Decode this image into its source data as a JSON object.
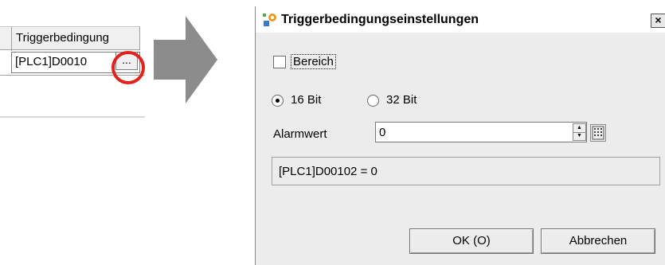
{
  "grid": {
    "column_header": "Triggerbedingung",
    "cell_value": "[PLC1]D0010",
    "ellipsis_label": "..."
  },
  "dialog": {
    "title": "Triggerbedingungseinstellungen",
    "close_label": "×",
    "range_checkbox_label": "Bereich",
    "range_checked": false,
    "radio_16_label": "16 Bit",
    "radio_32_label": "32 Bit",
    "selected_bit_mode": "16 Bit",
    "alarm_label": "Alarmwert",
    "alarm_value": "0",
    "preview_text": "[PLC1]D00102 = 0",
    "ok_label": "OK (O)",
    "cancel_label": "Abbrechen"
  },
  "colors": {
    "highlight_ring": "#e0231c",
    "arrow": "#8c8c8c",
    "dialog_background": "#ececec"
  },
  "icons": {
    "title": "settings-dialog-icon",
    "spin": "spin-updown-icon",
    "keypad": "keypad-icon",
    "arrow": "right-arrow-icon"
  }
}
